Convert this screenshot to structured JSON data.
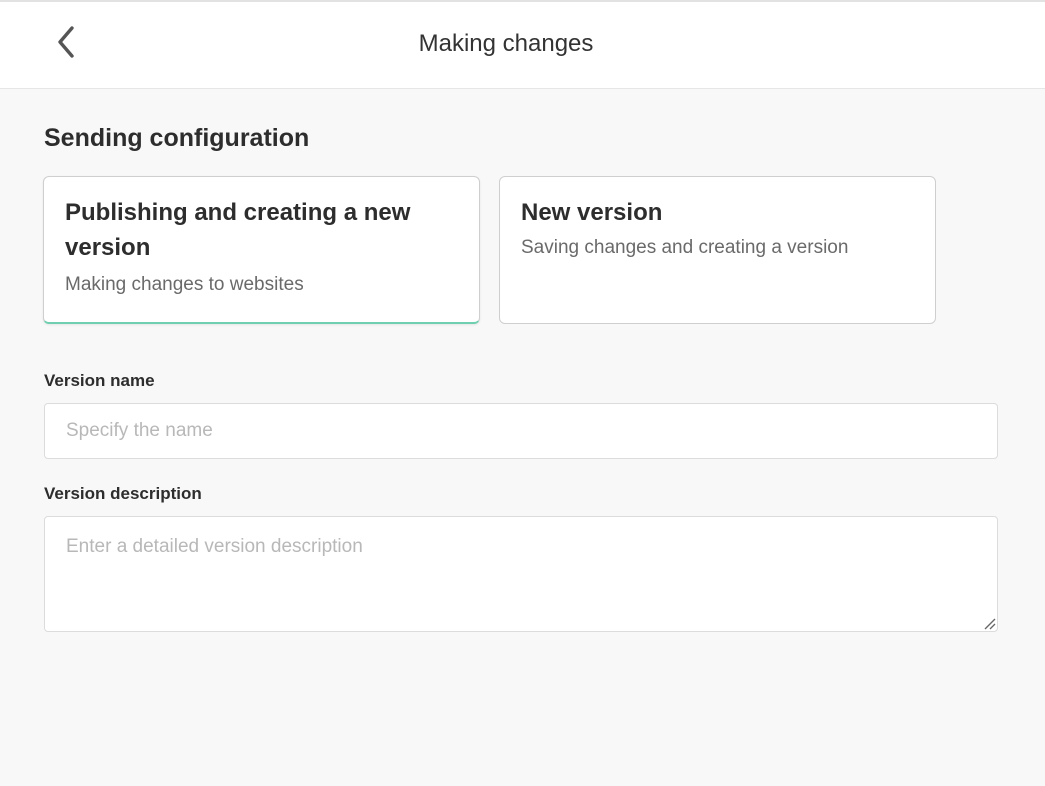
{
  "header": {
    "back_icon": "chevron-left-icon",
    "title": "Making changes"
  },
  "config": {
    "section_title": "Sending configuration",
    "selected_option": 0,
    "options": [
      {
        "title": "Publishing and creating a new version",
        "description": "Making changes to websites"
      },
      {
        "title": "New version",
        "description": "Saving changes and creating a version"
      }
    ]
  },
  "form": {
    "version_name": {
      "label": "Version name",
      "placeholder": "Specify the name",
      "value": ""
    },
    "version_description": {
      "label": "Version description",
      "placeholder": "Enter a detailed version description",
      "value": ""
    }
  },
  "colors": {
    "accent": "#6fcfb0",
    "background": "#f8f8f8",
    "header_background": "#ffffff"
  }
}
